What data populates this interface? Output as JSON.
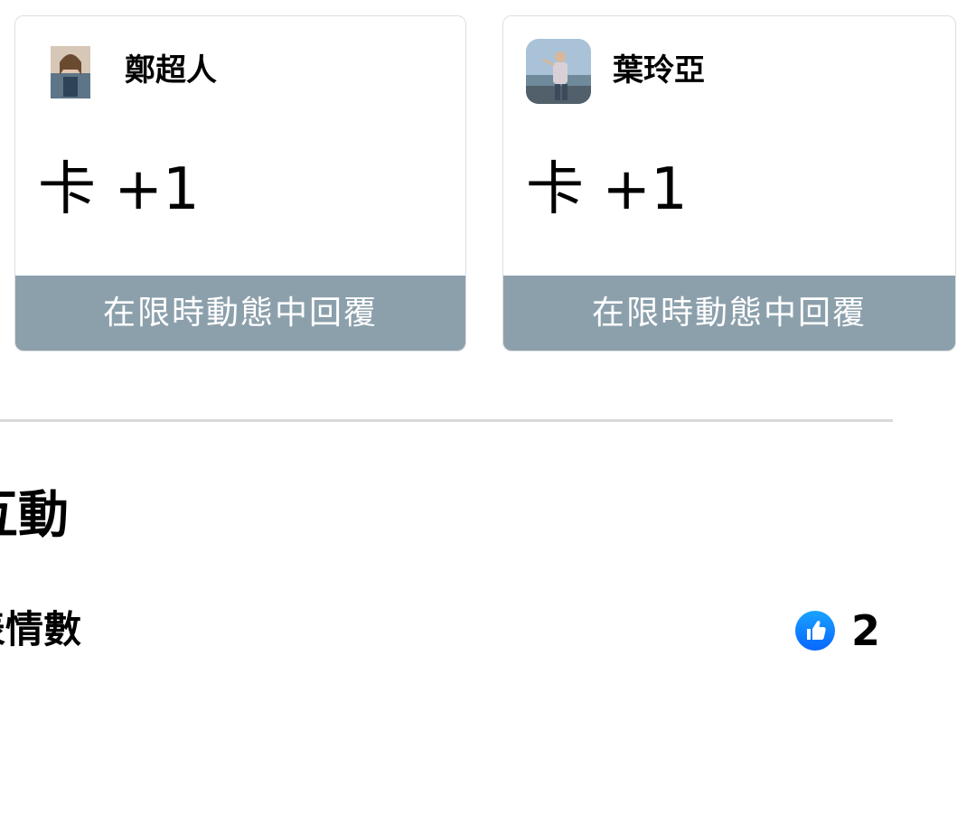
{
  "story_replies": [
    {
      "name": "鄭超人",
      "message": "卡 +1",
      "reply_label": "在限時動態中回覆",
      "avatar_icon": "user-avatar"
    },
    {
      "name": "葉玲亞",
      "message": "卡 +1",
      "reply_label": "在限時動態中回覆",
      "avatar_icon": "user-avatar"
    }
  ],
  "interactions": {
    "title": "互動",
    "metric_label": "表情數",
    "like_icon": "like-thumbs-up-icon",
    "like_count": "2",
    "accent_color": "#1877f2"
  }
}
